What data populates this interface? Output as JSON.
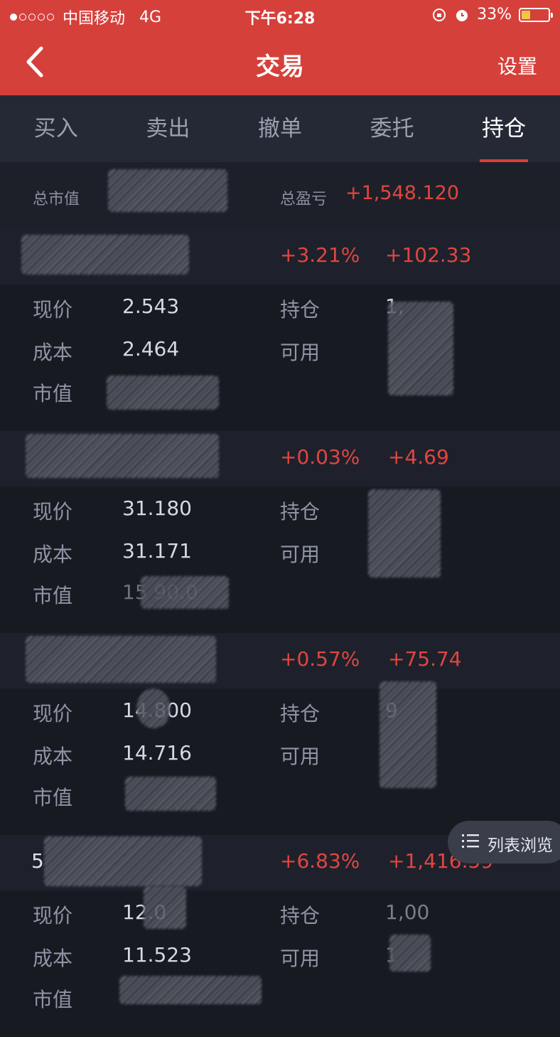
{
  "status_bar": {
    "carrier": "中国移动",
    "network": "4G",
    "time": "下午6:28",
    "battery": "33%",
    "signal_dots_filled": 1
  },
  "nav": {
    "title": "交易",
    "right_label": "设置",
    "back_icon": "chevron-left-icon"
  },
  "tabs": [
    {
      "label": "买入"
    },
    {
      "label": "卖出"
    },
    {
      "label": "撤单"
    },
    {
      "label": "委托"
    },
    {
      "label": "持仓",
      "active": true
    }
  ],
  "summary": {
    "market_value_label": "总市值",
    "profit_label": "总盈亏",
    "profit_value": "+1,548.120"
  },
  "labels": {
    "price": "现价",
    "cost": "成本",
    "market_value": "市值",
    "position": "持仓",
    "available": "可用"
  },
  "positions": [
    {
      "pct": "+3.21%",
      "pl": "+102.33",
      "price": "2.543",
      "cost": "2.464",
      "position": "1,",
      "available": ""
    },
    {
      "pct": "+0.03%",
      "pl": "+4.69",
      "price": "31.180",
      "cost": "31.171",
      "market_value": "15 90.0",
      "position": "",
      "available": ""
    },
    {
      "pct": "+0.57%",
      "pl": "+75.74",
      "price": "14.800",
      "cost": "14.716",
      "position": "9",
      "available": ""
    },
    {
      "name": "5",
      "pct": "+6.83%",
      "pl": "+1,416.59",
      "price": "12.0",
      "cost": "11.523",
      "position": "1,00",
      "available": "1"
    }
  ],
  "list_button": {
    "label": "列表浏览",
    "icon": "list-icon"
  },
  "colors": {
    "header_red": "#d6403b",
    "profit_red": "#e0463f",
    "bg_dark": "#1a1d27"
  }
}
